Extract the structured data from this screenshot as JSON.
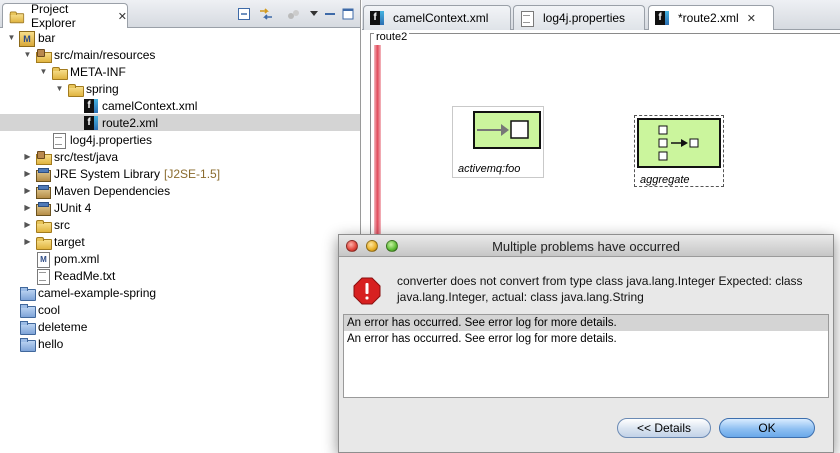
{
  "explorer": {
    "tab_label": "Project Explorer",
    "tree": [
      {
        "label": "bar",
        "icon": "mvnproj",
        "depth": 0,
        "twisty": "open"
      },
      {
        "label": "src/main/resources",
        "icon": "srcfolder",
        "depth": 1,
        "twisty": "open"
      },
      {
        "label": "META-INF",
        "icon": "folder",
        "depth": 2,
        "twisty": "open"
      },
      {
        "label": "spring",
        "icon": "folder",
        "depth": 3,
        "twisty": "open"
      },
      {
        "label": "camelContext.xml",
        "icon": "xmlfile",
        "depth": 4,
        "twisty": "none"
      },
      {
        "label": "route2.xml",
        "icon": "xmlfile",
        "depth": 4,
        "twisty": "none",
        "selected": true
      },
      {
        "label": "log4j.properties",
        "icon": "propfile",
        "depth": 2,
        "twisty": "none"
      },
      {
        "label": "src/test/java",
        "icon": "srcfolder",
        "depth": 1,
        "twisty": "closed"
      },
      {
        "label": "JRE System Library",
        "icon": "library",
        "depth": 1,
        "twisty": "closed",
        "decoration": "[J2SE-1.5]"
      },
      {
        "label": "Maven Dependencies",
        "icon": "library",
        "depth": 1,
        "twisty": "closed"
      },
      {
        "label": "JUnit 4",
        "icon": "library",
        "depth": 1,
        "twisty": "closed"
      },
      {
        "label": "src",
        "icon": "folder",
        "depth": 1,
        "twisty": "closed"
      },
      {
        "label": "target",
        "icon": "folder",
        "depth": 1,
        "twisty": "closed"
      },
      {
        "label": "pom.xml",
        "icon": "pomfile",
        "depth": 1,
        "twisty": "none"
      },
      {
        "label": "ReadMe.txt",
        "icon": "txtfile",
        "depth": 1,
        "twisty": "none"
      },
      {
        "label": "camel-example-spring",
        "icon": "project",
        "depth": 0,
        "twisty": "none"
      },
      {
        "label": "cool",
        "icon": "project",
        "depth": 0,
        "twisty": "none"
      },
      {
        "label": "deleteme",
        "icon": "project",
        "depth": 0,
        "twisty": "none"
      },
      {
        "label": "hello",
        "icon": "project",
        "depth": 0,
        "twisty": "none"
      }
    ]
  },
  "editor": {
    "tabs": [
      {
        "label": "camelContext.xml",
        "icon": "xmlfile",
        "active": false
      },
      {
        "label": "log4j.properties",
        "icon": "propfile",
        "active": false
      },
      {
        "label": "*route2.xml",
        "icon": "xmlfile",
        "active": true
      }
    ],
    "route_label": "route2",
    "nodes": {
      "endpoint_caption": "activemq:foo",
      "aggregate_caption": "aggregate"
    }
  },
  "dialog": {
    "title": "Multiple problems have occurred",
    "message": "converter does not convert from type class java.lang.Integer Expected: class java.lang.Integer, actual: class java.lang.String",
    "errors": [
      "An error has occurred. See error log for more details.",
      "An error has occurred. See error log for more details."
    ],
    "details_label": "<< Details",
    "ok_label": "OK"
  },
  "colors": {
    "selection": "#d4d4d4",
    "node_fill": "#cbf59d",
    "route_bar": "#e24a5a",
    "error_red": "#d72020"
  }
}
